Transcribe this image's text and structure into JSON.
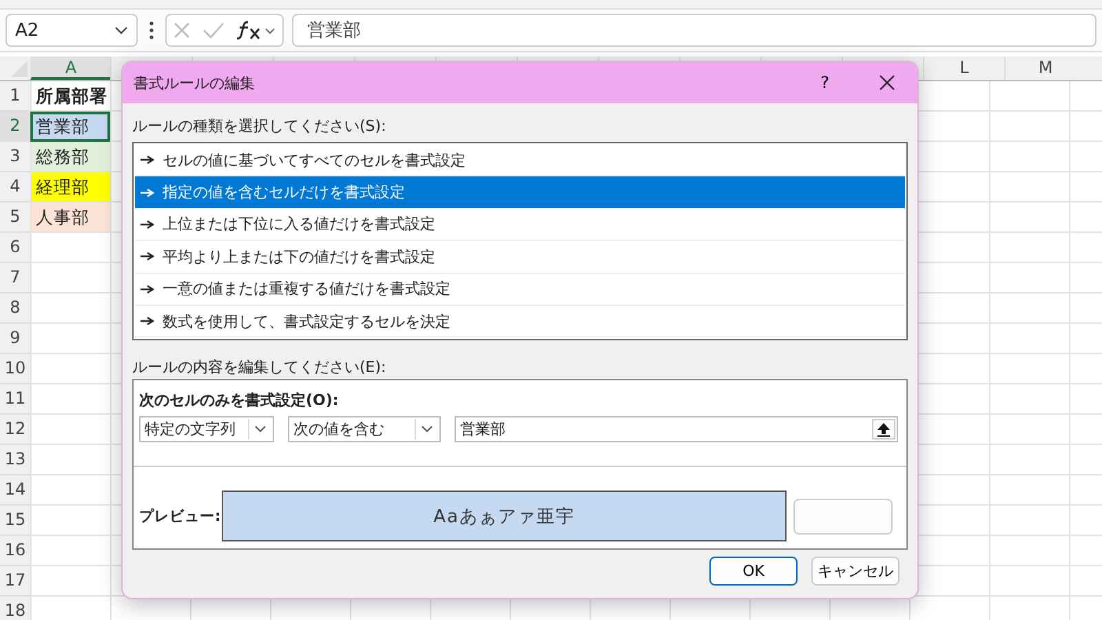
{
  "formula_bar": {
    "name_box": "A2",
    "formula": "営業部"
  },
  "sheet": {
    "columns": [
      {
        "label": "A",
        "kind": "data"
      },
      {
        "label": "L",
        "kind": "right"
      },
      {
        "label": "M",
        "kind": "right"
      }
    ],
    "row_numbers": [
      "1",
      "2",
      "3",
      "4",
      "5",
      "6",
      "7",
      "8",
      "9",
      "10",
      "11",
      "12",
      "13",
      "14",
      "15",
      "16",
      "17",
      "18"
    ],
    "cells": [
      {
        "text": "所属部署",
        "bold": true,
        "selected": false
      },
      {
        "text": "営業部",
        "bold": false,
        "selected": true,
        "color": "#c5d9f1"
      },
      {
        "text": "総務部",
        "bold": false,
        "selected": false,
        "color": "#e2efda"
      },
      {
        "text": "経理部",
        "bold": false,
        "selected": false,
        "color": "#ffff00"
      },
      {
        "text": "人事部",
        "bold": false,
        "selected": false,
        "color": "#fce4d6"
      }
    ]
  },
  "dialog": {
    "title": "書式ルールの編集",
    "help": "?",
    "rule_type_label": "ルールの種類を選択してください(S):",
    "rule_types": [
      {
        "label": "セルの値に基づいてすべてのセルを書式設定",
        "selected": false
      },
      {
        "label": "指定の値を含むセルだけを書式設定",
        "selected": true
      },
      {
        "label": "上位または下位に入る値だけを書式設定",
        "selected": false
      },
      {
        "label": "平均より上または下の値だけを書式設定",
        "selected": false
      },
      {
        "label": "一意の値または重複する値だけを書式設定",
        "selected": false
      },
      {
        "label": "数式を使用して、書式設定するセルを決定",
        "selected": false
      }
    ],
    "edit_label": "ルールの内容を編集してください(E):",
    "condition_label": "次のセルのみを書式設定(O):",
    "condition_type": "特定の文字列",
    "operator": "次の値を含む",
    "value": "営業部",
    "preview_label": "プレビュー:",
    "preview_text": "Aaあぁアァ亜宇",
    "buttons": [
      "OK",
      "キャンセル"
    ]
  }
}
